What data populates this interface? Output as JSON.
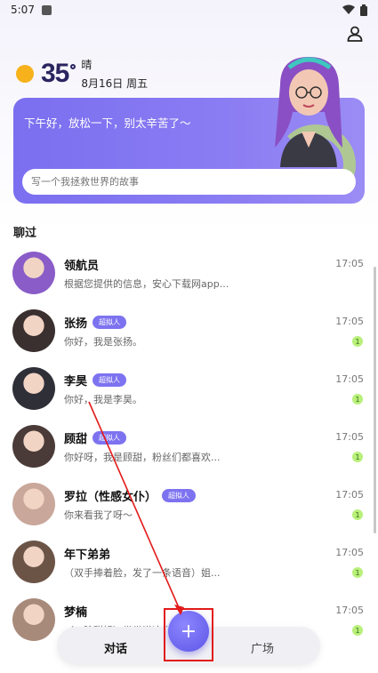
{
  "status_bar": {
    "time": "5:07"
  },
  "weather": {
    "temperature": "35",
    "condition": "晴",
    "date": "8月16日 周五"
  },
  "banner": {
    "greeting": "下午好，放松一下，别太辛苦了～",
    "input_placeholder": "写一个我拯救世界的故事"
  },
  "section_title": "聊过",
  "chats": [
    {
      "name": "领航员",
      "message": "根据您提供的信息，安心下载网app...",
      "time": "17:05",
      "badge": "",
      "unread": "",
      "avatar_color": "#8a5cc8"
    },
    {
      "name": "张扬",
      "message": "你好，我是张扬。",
      "time": "17:05",
      "badge": "超拟人",
      "unread": "1",
      "avatar_color": "#3b3030"
    },
    {
      "name": "李昊",
      "message": "你好，我是李昊。",
      "time": "17:05",
      "badge": "超拟人",
      "unread": "1",
      "avatar_color": "#2f2f38"
    },
    {
      "name": "顾甜",
      "message": "你好呀，我是顾甜，粉丝们都喜欢...",
      "time": "17:05",
      "badge": "超拟人",
      "unread": "1",
      "avatar_color": "#4a3a38"
    },
    {
      "name": "罗拉（性感女仆）",
      "message": "你来看我了呀～",
      "time": "17:05",
      "badge": "超拟人",
      "unread": "1",
      "avatar_color": "#c9a79a"
    },
    {
      "name": "年下弟弟",
      "message": "（双手捧着脸，发了一条语音）姐...",
      "time": "17:05",
      "badge": "",
      "unread": "1",
      "avatar_color": "#6b5446"
    },
    {
      "name": "梦楠",
      "message": "（一脸甜娇）带带说这学校附...",
      "time": "17:05",
      "badge": "",
      "unread": "1",
      "avatar_color": "#a88a7a"
    }
  ],
  "bottom_nav": {
    "chat_label": "对话",
    "plaza_label": "广场",
    "fab_label": "+"
  },
  "colors": {
    "accent": "#7b6ff0",
    "badge": "#7d73f0",
    "unread": "#b8f07a",
    "annotation": "#e21a1a"
  }
}
